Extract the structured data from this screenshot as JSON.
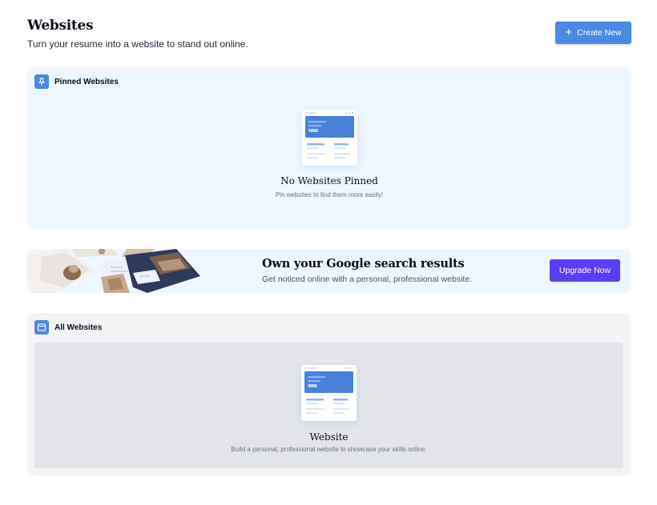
{
  "header": {
    "title": "Websites",
    "subtitle": "Turn your resume into a website to stand out online.",
    "create_label": "Create New",
    "create_icon": "plus-icon"
  },
  "pinned": {
    "title": "Pinned Websites",
    "icon": "pin-icon",
    "empty_title": "No Websites Pinned",
    "empty_desc": "Pin websites to find them more easily!"
  },
  "banner": {
    "title": "Own your Google search results",
    "desc": "Get noticed online with a personal, professional website.",
    "button_label": "Upgrade Now"
  },
  "all": {
    "title": "All Websites",
    "icon": "browser-window-icon",
    "empty_title": "Website",
    "empty_desc": "Build a personal, professional website to showcase your skills online."
  },
  "colors": {
    "accent": "#4a8ae0",
    "upgrade": "#5b3df5",
    "panel_blue": "#eef6ff",
    "panel_gray": "#f3f4f6"
  }
}
